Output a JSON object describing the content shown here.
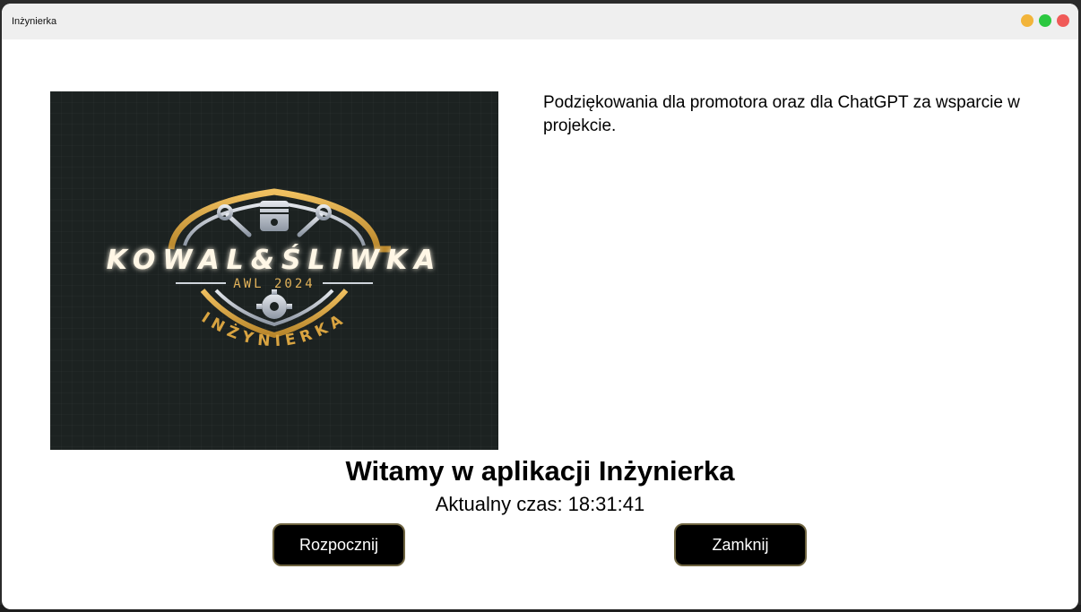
{
  "window": {
    "title": "Inżynierka"
  },
  "logo": {
    "brand": "KOWAL&ŚLIWKA",
    "subtitle": "AWL 2024",
    "arc_text": "INŻYNIERKA"
  },
  "main": {
    "thanks_text": "Podziękowania dla promotora oraz dla ChatGPT za wsparcie w projekcie.",
    "welcome_heading": "Witamy w aplikacji Inżynierka",
    "clock_label": "Aktualny czas:",
    "clock_value": "18:31:41"
  },
  "buttons": {
    "start_label": "Rozpocznij",
    "close_label": "Zamknij"
  },
  "colors": {
    "accent_gold": "#d9a441",
    "button_bg": "#000000",
    "logo_bg": "#1c2221"
  }
}
